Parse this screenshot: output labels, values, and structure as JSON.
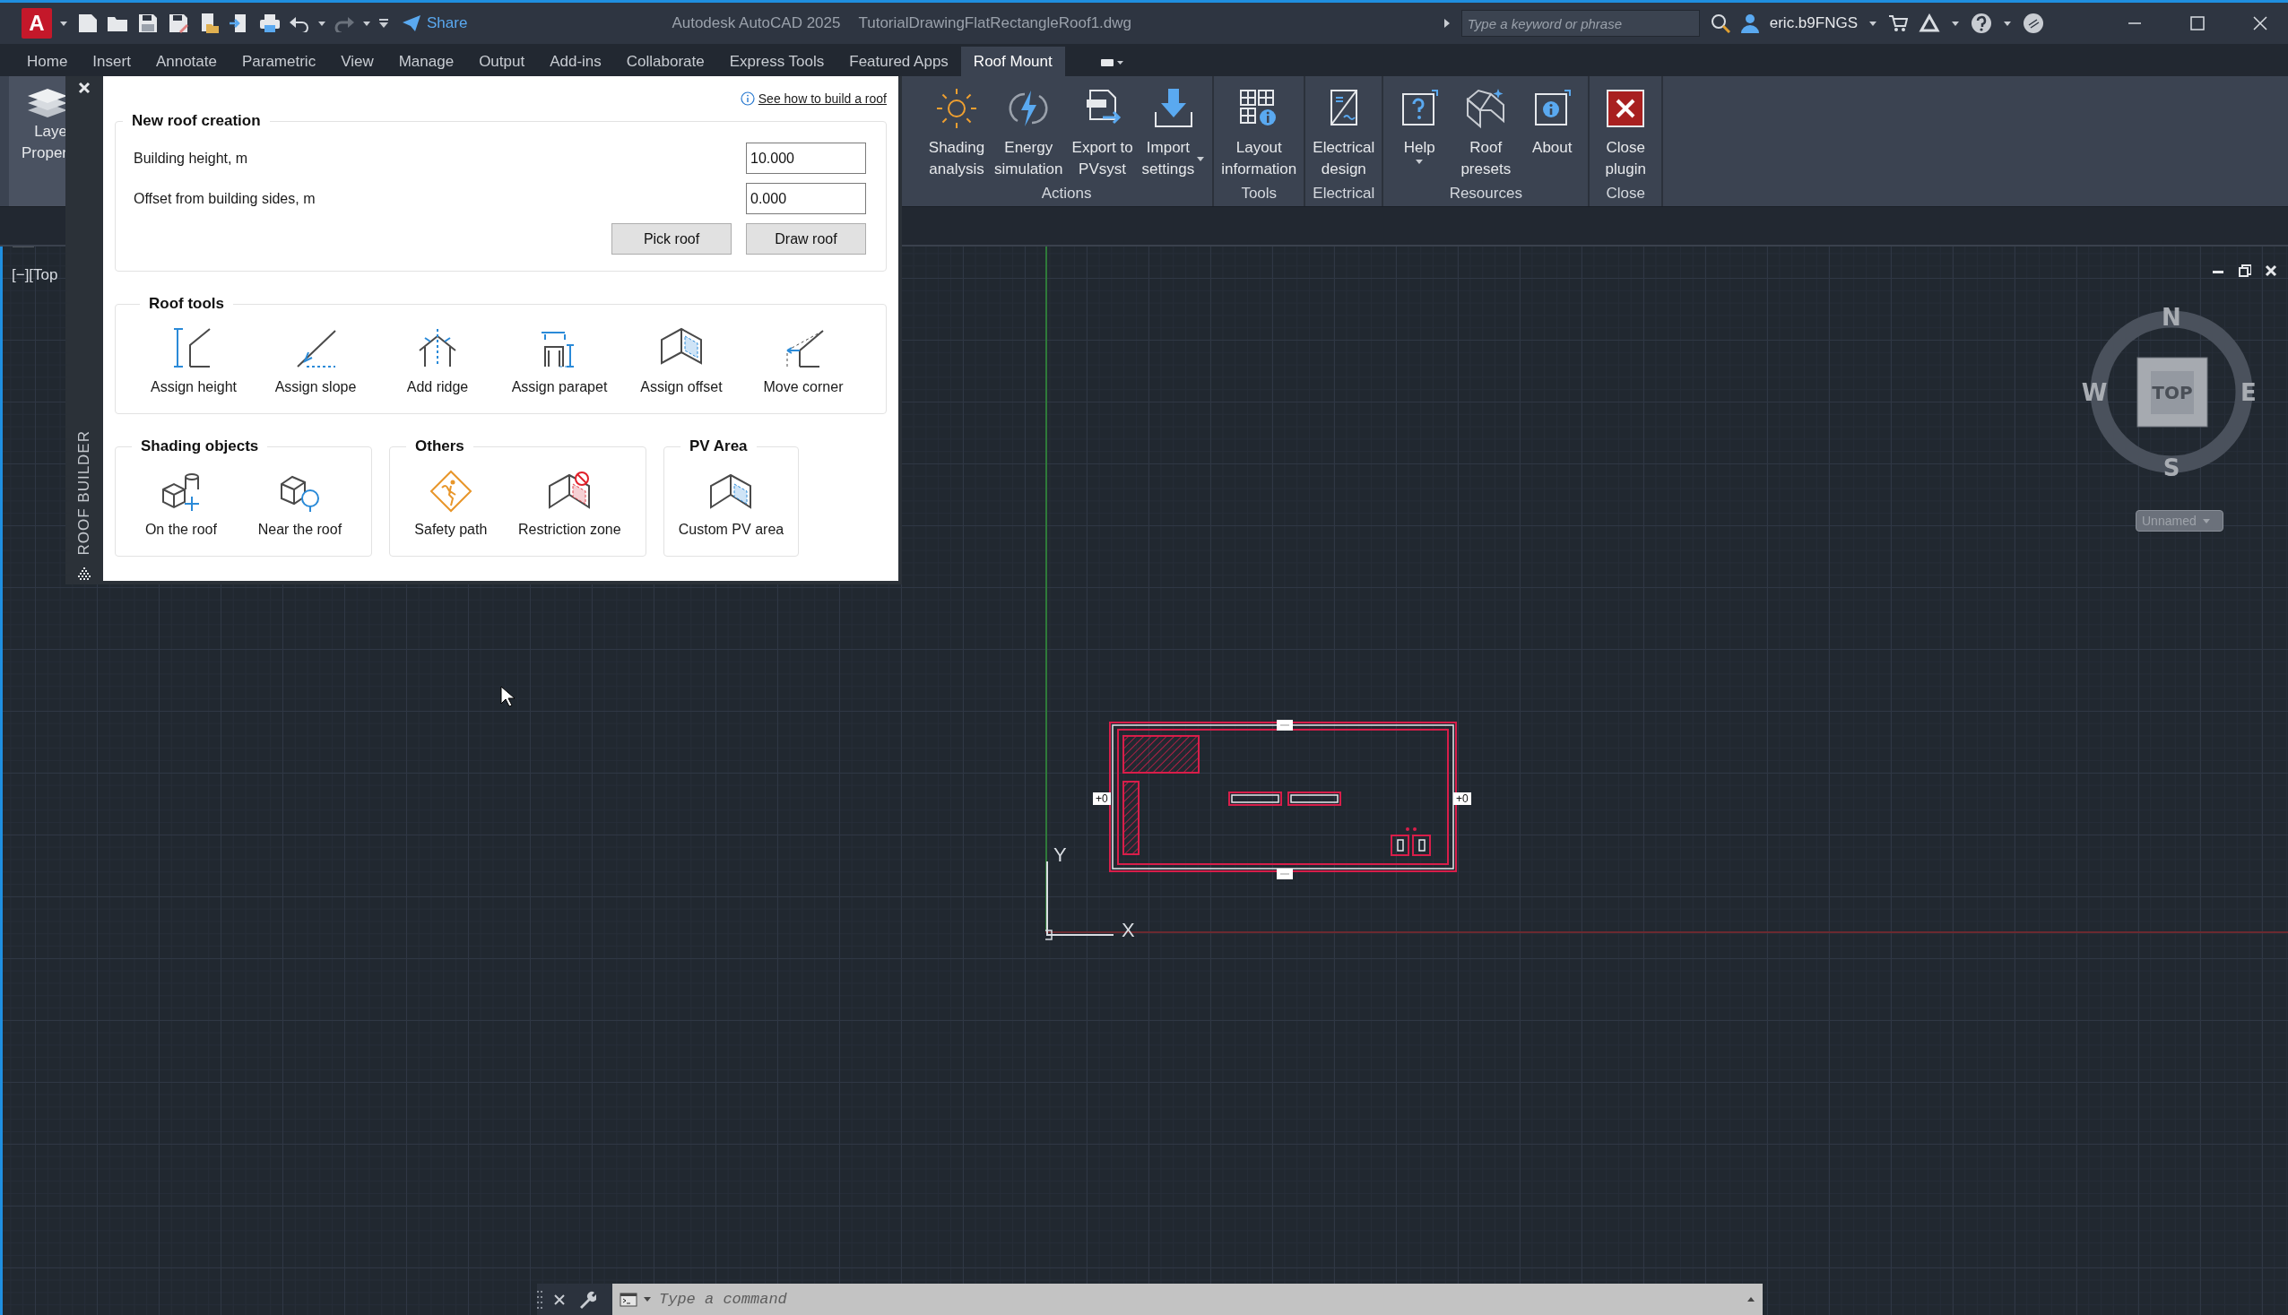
{
  "title_bar": {
    "app_logo": "A",
    "share": "Share",
    "app_name": "Autodesk AutoCAD 2025",
    "file_name": "TutorialDrawingFlatRectangleRoof1.dwg",
    "search": {
      "placeholder": "Type a keyword or phrase"
    },
    "user": "eric.b9FNGS"
  },
  "tabs": [
    {
      "label": "Home",
      "selected": false
    },
    {
      "label": "Insert",
      "selected": false
    },
    {
      "label": "Annotate",
      "selected": false
    },
    {
      "label": "Parametric",
      "selected": false
    },
    {
      "label": "View",
      "selected": false
    },
    {
      "label": "Manage",
      "selected": false
    },
    {
      "label": "Output",
      "selected": false
    },
    {
      "label": "Add-ins",
      "selected": false
    },
    {
      "label": "Collaborate",
      "selected": false
    },
    {
      "label": "Express Tools",
      "selected": false
    },
    {
      "label": "Featured Apps",
      "selected": false
    },
    {
      "label": "Roof Mount",
      "selected": true
    }
  ],
  "ribbon": {
    "layer_button": "Laye\nProper",
    "panels": [
      {
        "title": "Actions",
        "buttons": [
          {
            "label": "Shading\nanalysis",
            "dropdown": false
          },
          {
            "label": "Energy\nsimulation",
            "dropdown": false
          },
          {
            "label": "Export to\nPVsyst",
            "dropdown": false
          },
          {
            "label": "Import\nsettings",
            "dropdown": true
          }
        ]
      },
      {
        "title": "Tools",
        "buttons": [
          {
            "label": "Layout\ninformation",
            "dropdown": false
          }
        ]
      },
      {
        "title": "Electrical",
        "buttons": [
          {
            "label": "Electrical\ndesign",
            "dropdown": false
          }
        ]
      },
      {
        "title": "Resources",
        "buttons": [
          {
            "label": "Help",
            "dropdown": true
          },
          {
            "label": "Roof\npresets",
            "dropdown": false
          },
          {
            "label": "About",
            "dropdown": false
          }
        ]
      },
      {
        "title": "Close",
        "buttons": [
          {
            "label": "Close\nplugin",
            "dropdown": false
          }
        ]
      }
    ]
  },
  "roof_builder": {
    "title": "ROOF BUILDER",
    "help_link": "See how to build a roof",
    "new_roof": {
      "title": "New roof creation",
      "fields": [
        {
          "label": "Building height, m",
          "value": "10.000"
        },
        {
          "label": "Offset from building sides, m",
          "value": "0.000"
        }
      ],
      "buttons": [
        "Pick roof",
        "Draw roof"
      ]
    },
    "roof_tools": {
      "title": "Roof tools",
      "tools": [
        "Assign height",
        "Assign slope",
        "Add ridge",
        "Assign parapet",
        "Assign offset",
        "Move corner"
      ]
    },
    "groups": [
      {
        "title": "Shading objects",
        "tools": [
          "On the roof",
          "Near the roof"
        ]
      },
      {
        "title": "Others",
        "tools": [
          "Safety path",
          "Restriction zone"
        ]
      },
      {
        "title": "PV Area",
        "tools": [
          "Custom PV area"
        ]
      }
    ]
  },
  "viewport": {
    "view_label": "[−][Top",
    "viewcube": {
      "face": "TOP",
      "north": "N",
      "east": "E",
      "south": "S",
      "west": "W",
      "ucs": "Unnamed"
    },
    "ucs_icon": {
      "x": "X",
      "y": "Y"
    },
    "roof_tags": [
      "+0",
      "+0"
    ]
  },
  "command_line": {
    "placeholder": "Type a command"
  }
}
